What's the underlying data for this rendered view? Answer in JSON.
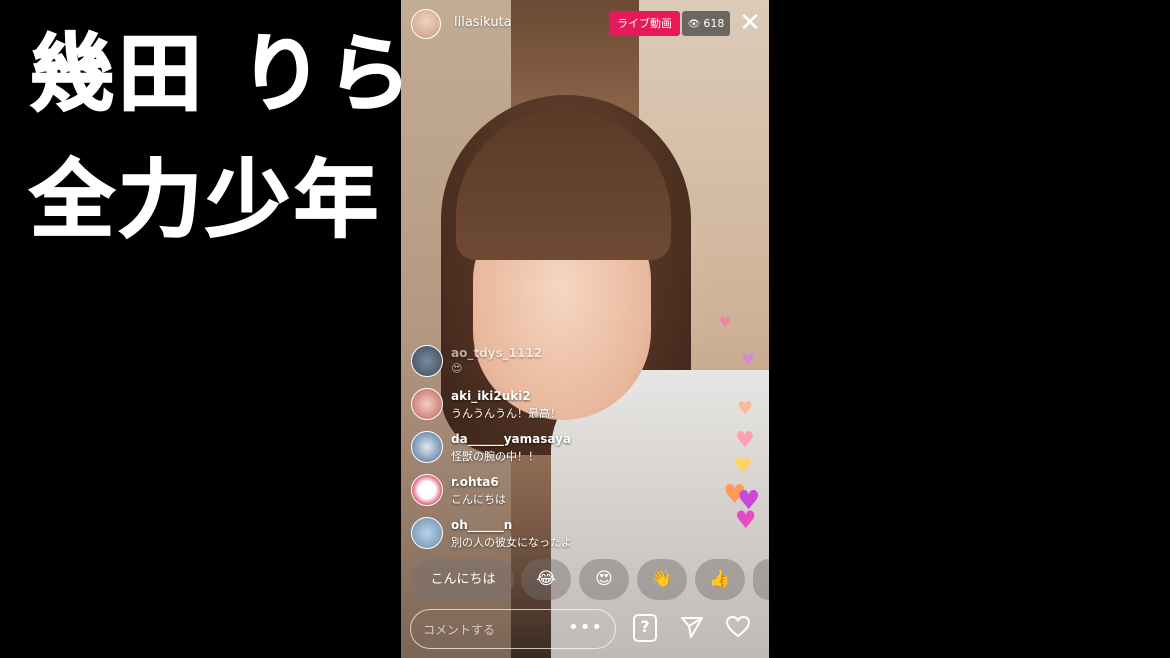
{
  "overlay_title": {
    "line1": "幾田 りら",
    "line2": "全力少年"
  },
  "live": {
    "username": "lilasikuta",
    "live_badge": "ライブ動画",
    "viewer_count": "618",
    "close_label": "✕"
  },
  "comments": [
    {
      "user": "ao_tdys_1112",
      "message": "😍"
    },
    {
      "user": "aki_iki2uki2",
      "message": "うんうんうん！最高！"
    },
    {
      "user": "da______yamasaya",
      "message": "怪獣の腕の中！！"
    },
    {
      "user": "r.ohta6",
      "message": "こんにちは"
    },
    {
      "user": "oh______n",
      "message": "別の人の彼女になったよ"
    }
  ],
  "quick_reactions": {
    "greeting": "こんにちは",
    "emoji1": "😂",
    "emoji2": "😍",
    "emoji3": "👋",
    "emoji4": "👍"
  },
  "comment_box": {
    "placeholder": "コメントする",
    "more": "•••"
  },
  "icons": {
    "qa": "?",
    "colors": {
      "live_red": "#e8195b"
    }
  }
}
